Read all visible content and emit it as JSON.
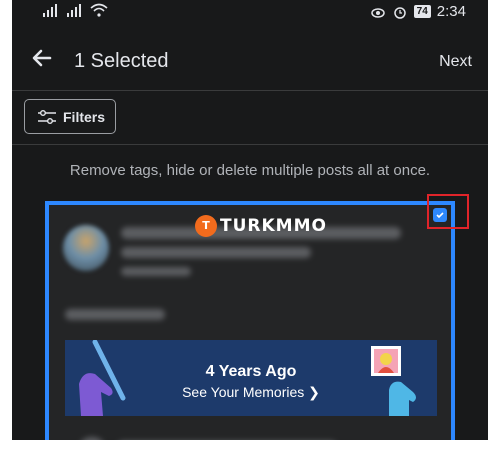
{
  "status_bar": {
    "time": "2:34",
    "battery": "74",
    "signal_icons": [
      "signal-icon",
      "signal-icon",
      "wifi-icon"
    ],
    "right_icons": [
      "eye-icon",
      "alarm-icon"
    ]
  },
  "header": {
    "title": "1 Selected",
    "next_label": "Next",
    "back_icon": "arrow-left-icon"
  },
  "toolbar": {
    "filters_label": "Filters",
    "filters_icon": "sliders-icon"
  },
  "info_text": "Remove tags, hide or delete multiple posts all at once.",
  "post": {
    "watermark": "TURKMMO",
    "watermark_logo": "T",
    "selected": true,
    "memories": {
      "title": "4 Years Ago",
      "subtitle": "See Your Memories ❯"
    }
  },
  "colors": {
    "background": "#18191a",
    "card": "#242526",
    "accent": "#2d88ff",
    "highlight_box": "#e0242a",
    "memories_bg": "#1d3a6b"
  }
}
